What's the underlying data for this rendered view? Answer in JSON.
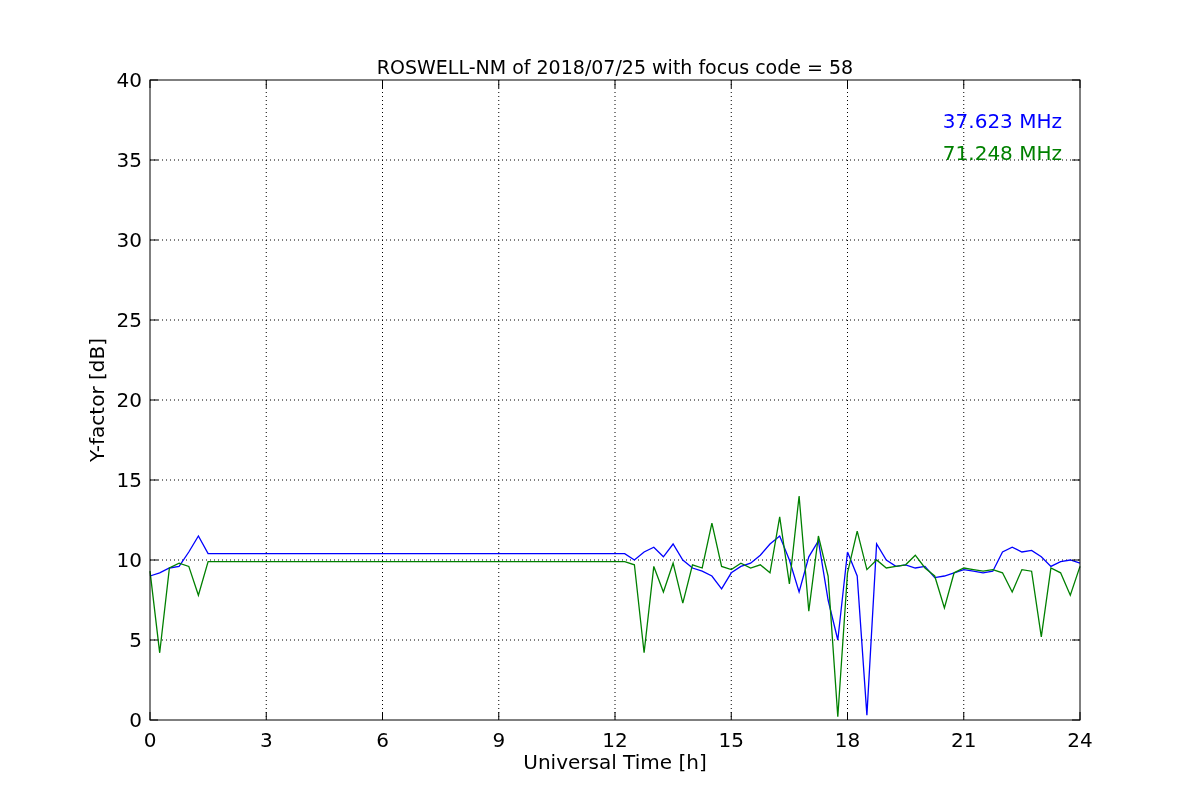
{
  "chart_data": {
    "type": "line",
    "title": "ROSWELL-NM of 2018/07/25 with focus code = 58",
    "xlabel": "Universal Time [h]",
    "ylabel": "Y-factor [dB]",
    "xlim": [
      0,
      24
    ],
    "ylim": [
      0,
      40
    ],
    "xticks": [
      0,
      3,
      6,
      9,
      12,
      15,
      18,
      21,
      24
    ],
    "yticks": [
      0,
      5,
      10,
      15,
      20,
      25,
      30,
      35,
      40
    ],
    "grid": true,
    "x": [
      0,
      0.25,
      0.5,
      0.75,
      1,
      1.25,
      1.5,
      1.75,
      2,
      2.25,
      2.5,
      2.75,
      3,
      3.25,
      3.5,
      3.75,
      4,
      4.25,
      4.5,
      4.75,
      5,
      5.25,
      5.5,
      5.75,
      6,
      6.25,
      6.5,
      6.75,
      7,
      7.25,
      7.5,
      7.75,
      8,
      8.25,
      8.5,
      8.75,
      9,
      9.25,
      9.5,
      9.75,
      10,
      10.25,
      10.5,
      10.75,
      11,
      11.25,
      11.5,
      11.75,
      12,
      12.25,
      12.5,
      12.75,
      13,
      13.25,
      13.5,
      13.75,
      14,
      14.25,
      14.5,
      14.75,
      15,
      15.25,
      15.5,
      15.75,
      16,
      16.25,
      16.5,
      16.75,
      17,
      17.25,
      17.5,
      17.75,
      18,
      18.25,
      18.5,
      18.75,
      19,
      19.25,
      19.5,
      19.75,
      20,
      20.25,
      20.5,
      20.75,
      21,
      21.25,
      21.5,
      21.75,
      22,
      22.25,
      22.5,
      22.75,
      23,
      23.25,
      23.5,
      23.75,
      24
    ],
    "series": [
      {
        "name": "37.623 MHz",
        "color": "#0000ff",
        "values": [
          9.0,
          9.2,
          9.5,
          9.6,
          10.5,
          11.5,
          10.4,
          10.4,
          10.4,
          10.4,
          10.4,
          10.4,
          10.4,
          10.4,
          10.4,
          10.4,
          10.4,
          10.4,
          10.4,
          10.4,
          10.4,
          10.4,
          10.4,
          10.4,
          10.4,
          10.4,
          10.4,
          10.4,
          10.4,
          10.4,
          10.4,
          10.4,
          10.4,
          10.4,
          10.4,
          10.4,
          10.4,
          10.4,
          10.4,
          10.4,
          10.4,
          10.4,
          10.4,
          10.4,
          10.4,
          10.4,
          10.4,
          10.4,
          10.4,
          10.4,
          10.0,
          10.5,
          10.8,
          10.2,
          11.0,
          10.0,
          9.5,
          9.3,
          9.0,
          8.2,
          9.2,
          9.6,
          9.8,
          10.3,
          11.0,
          11.5,
          10.0,
          8.0,
          10.2,
          11.2,
          7.5,
          5.0,
          10.5,
          9.0,
          0.3,
          11.0,
          10.0,
          9.6,
          9.7,
          9.5,
          9.6,
          8.9,
          9.0,
          9.2,
          9.4,
          9.3,
          9.2,
          9.3,
          10.5,
          10.8,
          10.5,
          10.6,
          10.2,
          9.6,
          9.9,
          10.0,
          9.8
        ]
      },
      {
        "name": "71.248 MHz",
        "color": "#008000",
        "values": [
          9.3,
          4.2,
          9.5,
          9.8,
          9.6,
          7.8,
          9.9,
          9.9,
          9.9,
          9.9,
          9.9,
          9.9,
          9.9,
          9.9,
          9.9,
          9.9,
          9.9,
          9.9,
          9.9,
          9.9,
          9.9,
          9.9,
          9.9,
          9.9,
          9.9,
          9.9,
          9.9,
          9.9,
          9.9,
          9.9,
          9.9,
          9.9,
          9.9,
          9.9,
          9.9,
          9.9,
          9.9,
          9.9,
          9.9,
          9.9,
          9.9,
          9.9,
          9.9,
          9.9,
          9.9,
          9.9,
          9.9,
          9.9,
          9.9,
          9.9,
          9.7,
          4.2,
          9.6,
          8.0,
          9.8,
          7.3,
          9.7,
          9.5,
          12.3,
          9.6,
          9.4,
          9.8,
          9.5,
          9.7,
          9.2,
          12.7,
          8.5,
          14.0,
          6.8,
          11.5,
          9.0,
          0.2,
          9.2,
          11.8,
          9.4,
          10.0,
          9.5,
          9.6,
          9.7,
          10.3,
          9.5,
          9.0,
          7.0,
          9.2,
          9.5,
          9.4,
          9.3,
          9.4,
          9.2,
          8.0,
          9.4,
          9.3,
          5.2,
          9.5,
          9.2,
          7.8,
          9.6
        ]
      }
    ]
  }
}
